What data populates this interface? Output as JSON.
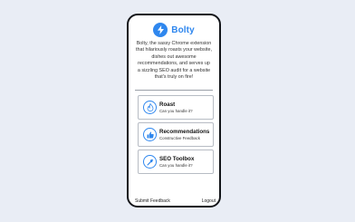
{
  "app": {
    "name": "Bolty",
    "description": "Bolty, the sassy Chrome extension that hilariously roasts your website, dishes out awesome recommendations, and serves up a sizzling SEO audit for a website that's truly on fire!"
  },
  "cards": [
    {
      "title": "Roast",
      "subtitle": "Can you handle it?",
      "icon": "flame-icon"
    },
    {
      "title": "Recommendations",
      "subtitle": "Constructive Feedback",
      "icon": "thumbs-up-icon"
    },
    {
      "title": "SEO Toolbox",
      "subtitle": "Can you handle it?",
      "icon": "wrench-icon"
    }
  ],
  "footer": {
    "feedback": "Submit Feedback",
    "logout": "Logout"
  },
  "colors": {
    "accent": "#2f87ee",
    "background": "#e9edf5"
  }
}
